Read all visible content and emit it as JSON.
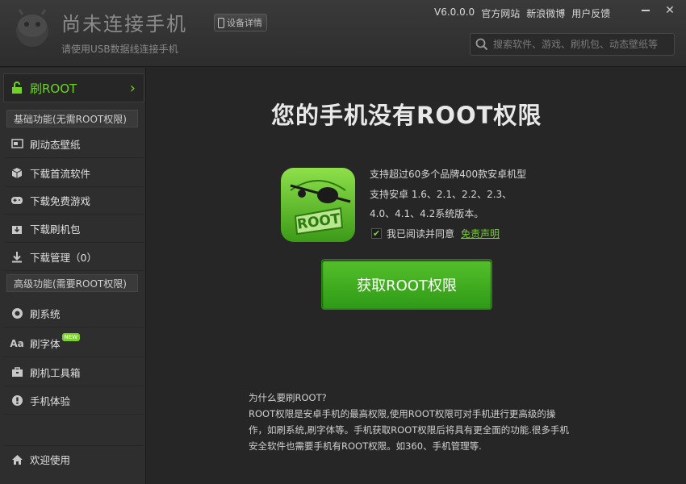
{
  "header": {
    "title": "尚未连接手机",
    "subtitle": "请使用USB数据线连接手机",
    "device_details": "设备详情",
    "version": "V6.0.0.0",
    "links": [
      "官方网站",
      "新浪微博",
      "用户反馈"
    ],
    "search_placeholder": "搜索软件、游戏、刷机包、动态壁纸等"
  },
  "sidebar": {
    "root_label": "刷ROOT",
    "basic_header": "基础功能(无需ROOT权限)",
    "basic_items": [
      {
        "label": "刷动态壁纸",
        "icon": "wallpaper-icon"
      },
      {
        "label": "下载首流软件",
        "icon": "box-icon"
      },
      {
        "label": "下载免费游戏",
        "icon": "gamepad-icon"
      },
      {
        "label": "下载刷机包",
        "icon": "download-box-icon"
      },
      {
        "label": "下载管理（0）",
        "icon": "download-icon"
      }
    ],
    "advanced_header": "高级功能(需要ROOT权限)",
    "advanced_items": [
      {
        "label": "刷系统",
        "icon": "system-icon"
      },
      {
        "label": "刷字体",
        "icon": "font-icon",
        "badge": "NEW"
      },
      {
        "label": "刷机工具箱",
        "icon": "toolbox-icon"
      },
      {
        "label": "手机体验",
        "icon": "experience-icon"
      }
    ],
    "welcome": "欢迎使用"
  },
  "main": {
    "title": "您的手机没有ROOT权限",
    "icon_text": "ROOT",
    "features": [
      "支持超过60多个品牌400款安卓机型",
      "支持安卓 1.6、2.1、2.2、2.3、",
      "4.0、4.1、4.2系统版本。"
    ],
    "agree_text": "我已阅读并同意",
    "disclaimer": "免责声明",
    "button": "获取ROOT权限",
    "why_title": "为什么要刷ROOT?",
    "why_body": "ROOT权限是安卓手机的最高权限,使用ROOT权限可对手机进行更高级的操作，如刷系统,刷字体等。手机获取ROOT权限后将具有更全面的功能.很多手机安全软件也需要手机有ROOT权限。如360、手机管理等."
  },
  "colors": {
    "accent": "#6fd224",
    "button": "#3aa81c",
    "background": "#262626"
  }
}
